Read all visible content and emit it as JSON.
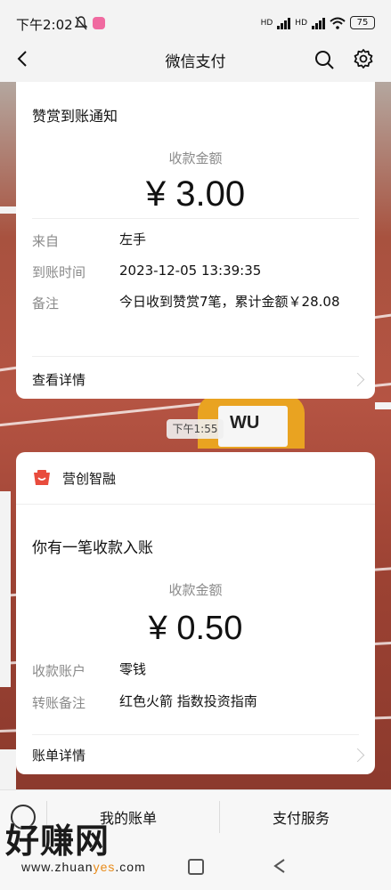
{
  "status_bar": {
    "time": "下午2:02",
    "net1": "HD",
    "net2": "HD",
    "battery": "75"
  },
  "nav": {
    "title": "微信支付",
    "back_icon": "chevron-left-icon",
    "search_icon": "search-icon",
    "settings_icon": "gear-icon"
  },
  "card1": {
    "title": "赞赏到账通知",
    "amount_label": "收款金额",
    "amount": "¥ 3.00",
    "rows": [
      {
        "label": "来自",
        "value": "左手"
      },
      {
        "label": "到账时间",
        "value": "2023-12-05 13:39:35"
      },
      {
        "label": "备注",
        "value": "今日收到赞赏7笔，累计金额￥28.08"
      }
    ],
    "footer": "查看详情"
  },
  "time_chip": "下午1:55",
  "background": {
    "bib": "WU"
  },
  "card2": {
    "brand": "营创智融",
    "title": "你有一笔收款入账",
    "amount_label": "收款金额",
    "amount": "¥ 0.50",
    "rows": [
      {
        "label": "收款账户",
        "value": "零钱"
      },
      {
        "label": "转账备注",
        "value": "红色火箭 指数投资指南"
      }
    ],
    "footer": "账单详情"
  },
  "bottom_menu": {
    "items": [
      "我的账单",
      "支付服务"
    ]
  },
  "watermark": {
    "text": "好赚网",
    "url_prefix": "www.zhuan",
    "url_highlight": "yes",
    "url_suffix": ".com"
  },
  "colors": {
    "accent_red": "#e84c3d",
    "text_main": "#111111",
    "text_muted": "#8a8a8a"
  }
}
